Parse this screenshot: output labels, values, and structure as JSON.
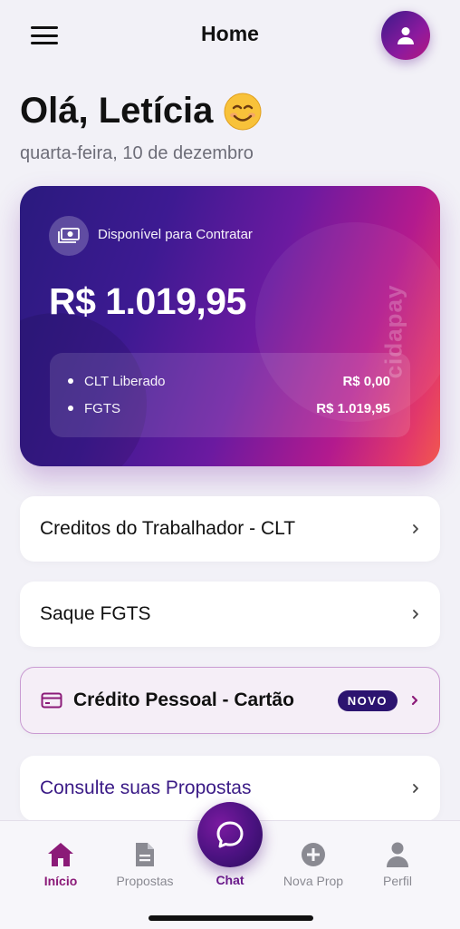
{
  "header": {
    "title": "Home"
  },
  "greeting": {
    "text": "Olá, Letícia",
    "date": "quarta-feira, 10 de dezembro"
  },
  "balance_card": {
    "label": "Disponível para Contratar",
    "amount": "R$ 1.019,95",
    "brand": "cidapay",
    "rows": [
      {
        "label": "CLT Liberado",
        "value": "R$ 0,00"
      },
      {
        "label": "FGTS",
        "value": "R$ 1.019,95"
      }
    ]
  },
  "menu": {
    "clt": "Creditos do Trabalhador - CLT",
    "fgts": "Saque FGTS",
    "credito_pessoal": "Crédito Pessoal - Cartão",
    "credito_badge": "NOVO",
    "propostas": "Consulte suas Propostas"
  },
  "nav": {
    "inicio": "Início",
    "propostas": "Propostas",
    "chat": "Chat",
    "nova_prop": "Nova Prop",
    "perfil": "Perfil"
  },
  "colors": {
    "accent": "#8b1a78",
    "card_start": "#2a1a7e",
    "card_end": "#f2584e"
  }
}
